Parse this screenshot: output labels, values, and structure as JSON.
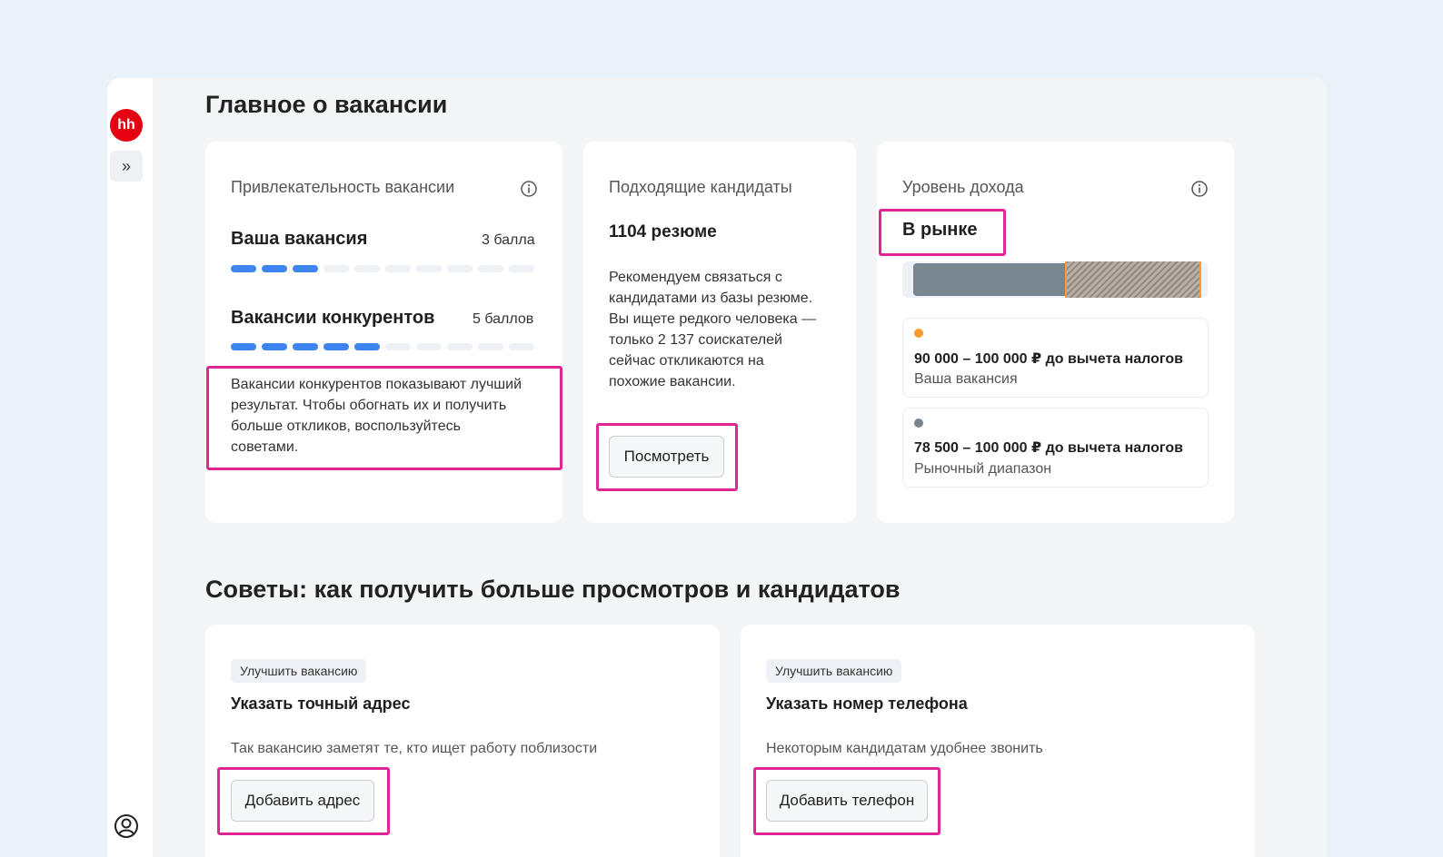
{
  "sidebar": {
    "logo_text": "hh",
    "expand_icon": "chevron-double-right-icon",
    "profile_icon": "user-circle-icon"
  },
  "main": {
    "title": "Главное о вакансии",
    "tips_title": "Советы: как получить больше просмотров и кандидатов"
  },
  "attractiveness": {
    "title": "Привлекательность вакансии",
    "info_icon": "info-icon",
    "yours_label": "Ваша вакансия",
    "yours_score": "3 балла",
    "yours_level": 3,
    "competitors_label": "Вакансии конкурентов",
    "competitors_score": "5 баллов",
    "competitors_level": 5,
    "max_level": 10,
    "note": "Вакансии конкурентов показывают лучший результат. Чтобы обогнать их и получить больше откликов, воспользуйтесь советами."
  },
  "candidates": {
    "title": "Подходящие кандидаты",
    "count": "1104 резюме",
    "text": "Рекомендуем связаться с кандидатами из базы резюме. Вы ищете редкого человека — только 2 137 соискателей сейчас откликаются на похожие вакансии.",
    "button": "Посмотреть"
  },
  "income": {
    "title": "Уровень дохода",
    "info_icon": "info-icon",
    "status": "В рынке",
    "vacancy_range": "90 000 – 100 000 ₽ до вычета налогов",
    "vacancy_label": "Ваша вакансия",
    "market_range": "78 500 – 100 000 ₽ до вычета налогов",
    "market_label": "Рыночный диапазон",
    "colors": {
      "vacancy": "#ff9a2e",
      "market": "#7a8592"
    }
  },
  "tips": [
    {
      "tag": "Улучшить вакансию",
      "title": "Указать точный адрес",
      "text": "Так вакансию заметят те, кто ищет работу поблизости",
      "button": "Добавить адрес"
    },
    {
      "tag": "Улучшить вакансию",
      "title": "Указать номер телефона",
      "text": "Некоторым кандидатам удобнее звонить",
      "button": "Добавить телефон"
    }
  ],
  "highlight_color": "#e02693"
}
